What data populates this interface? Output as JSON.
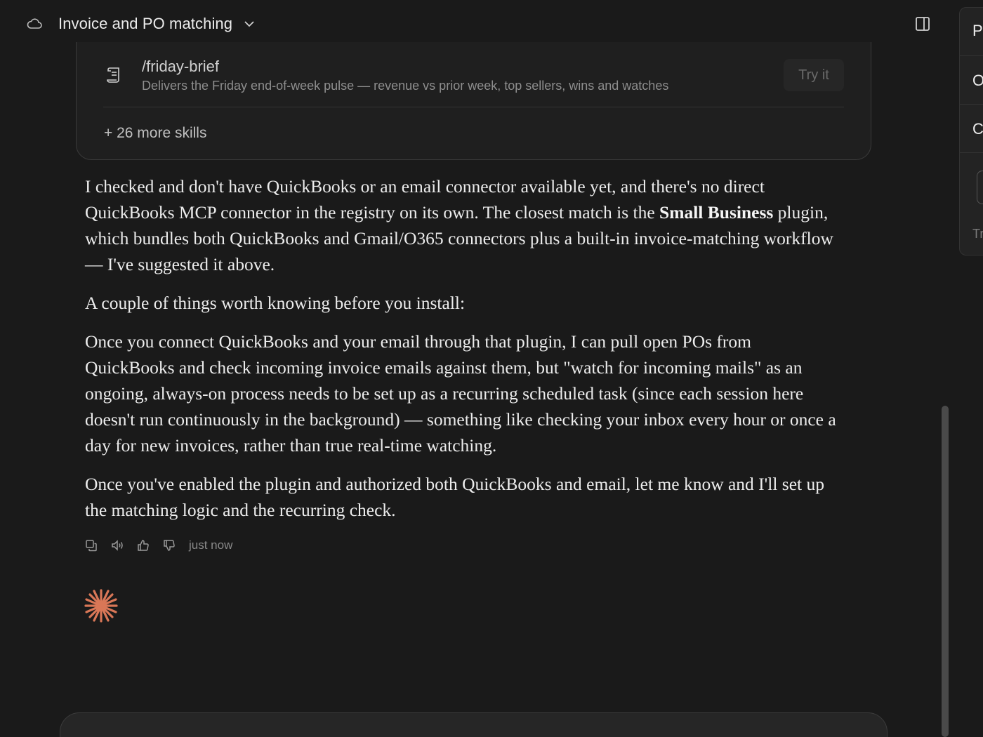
{
  "header": {
    "title": "Invoice and PO matching"
  },
  "side_panel": {
    "letters": [
      "P",
      "O",
      "C"
    ],
    "bottom_text": "Tr"
  },
  "skills_card": {
    "skill": {
      "name": "/friday-brief",
      "description": "Delivers the Friday end-of-week pulse — revenue vs prior week, top sellers, wins and watches",
      "try_label": "Try it"
    },
    "more_label": "+ 26 more skills"
  },
  "message": {
    "p1_a": "I checked and don't have QuickBooks or an email connector available yet, and there's no direct QuickBooks MCP connector in the registry on its own. The closest match is the ",
    "p1_bold": "Small Business",
    "p1_b": " plugin, which bundles both QuickBooks and Gmail/O365 connectors plus a built-in invoice-matching workflow — I've suggested it above.",
    "p2": "A couple of things worth knowing before you install:",
    "p3": "Once you connect QuickBooks and your email through that plugin, I can pull open POs from QuickBooks and check incoming invoice emails against them, but \"watch for incoming mails\" as an ongoing, always-on process needs to be set up as a recurring scheduled task (since each session here doesn't run continuously in the background) — something like checking your inbox every hour or once a day for new invoices, rather than true real-time watching.",
    "p4": "Once you've enabled the plugin and authorized both QuickBooks and email, let me know and I'll set up the matching logic and the recurring check.",
    "timestamp": "just now"
  },
  "icons": {
    "cloud": "cloud-icon",
    "chevron": "chevron-down-icon",
    "panel": "sidebar-toggle-icon",
    "skill": "scroll-icon",
    "copy": "copy-icon",
    "speak": "speaker-icon",
    "up": "thumbs-up-icon",
    "down": "thumbs-down-icon",
    "spark": "spark-icon"
  },
  "colors": {
    "background": "#1a1a1a",
    "accent": "#d97757"
  }
}
